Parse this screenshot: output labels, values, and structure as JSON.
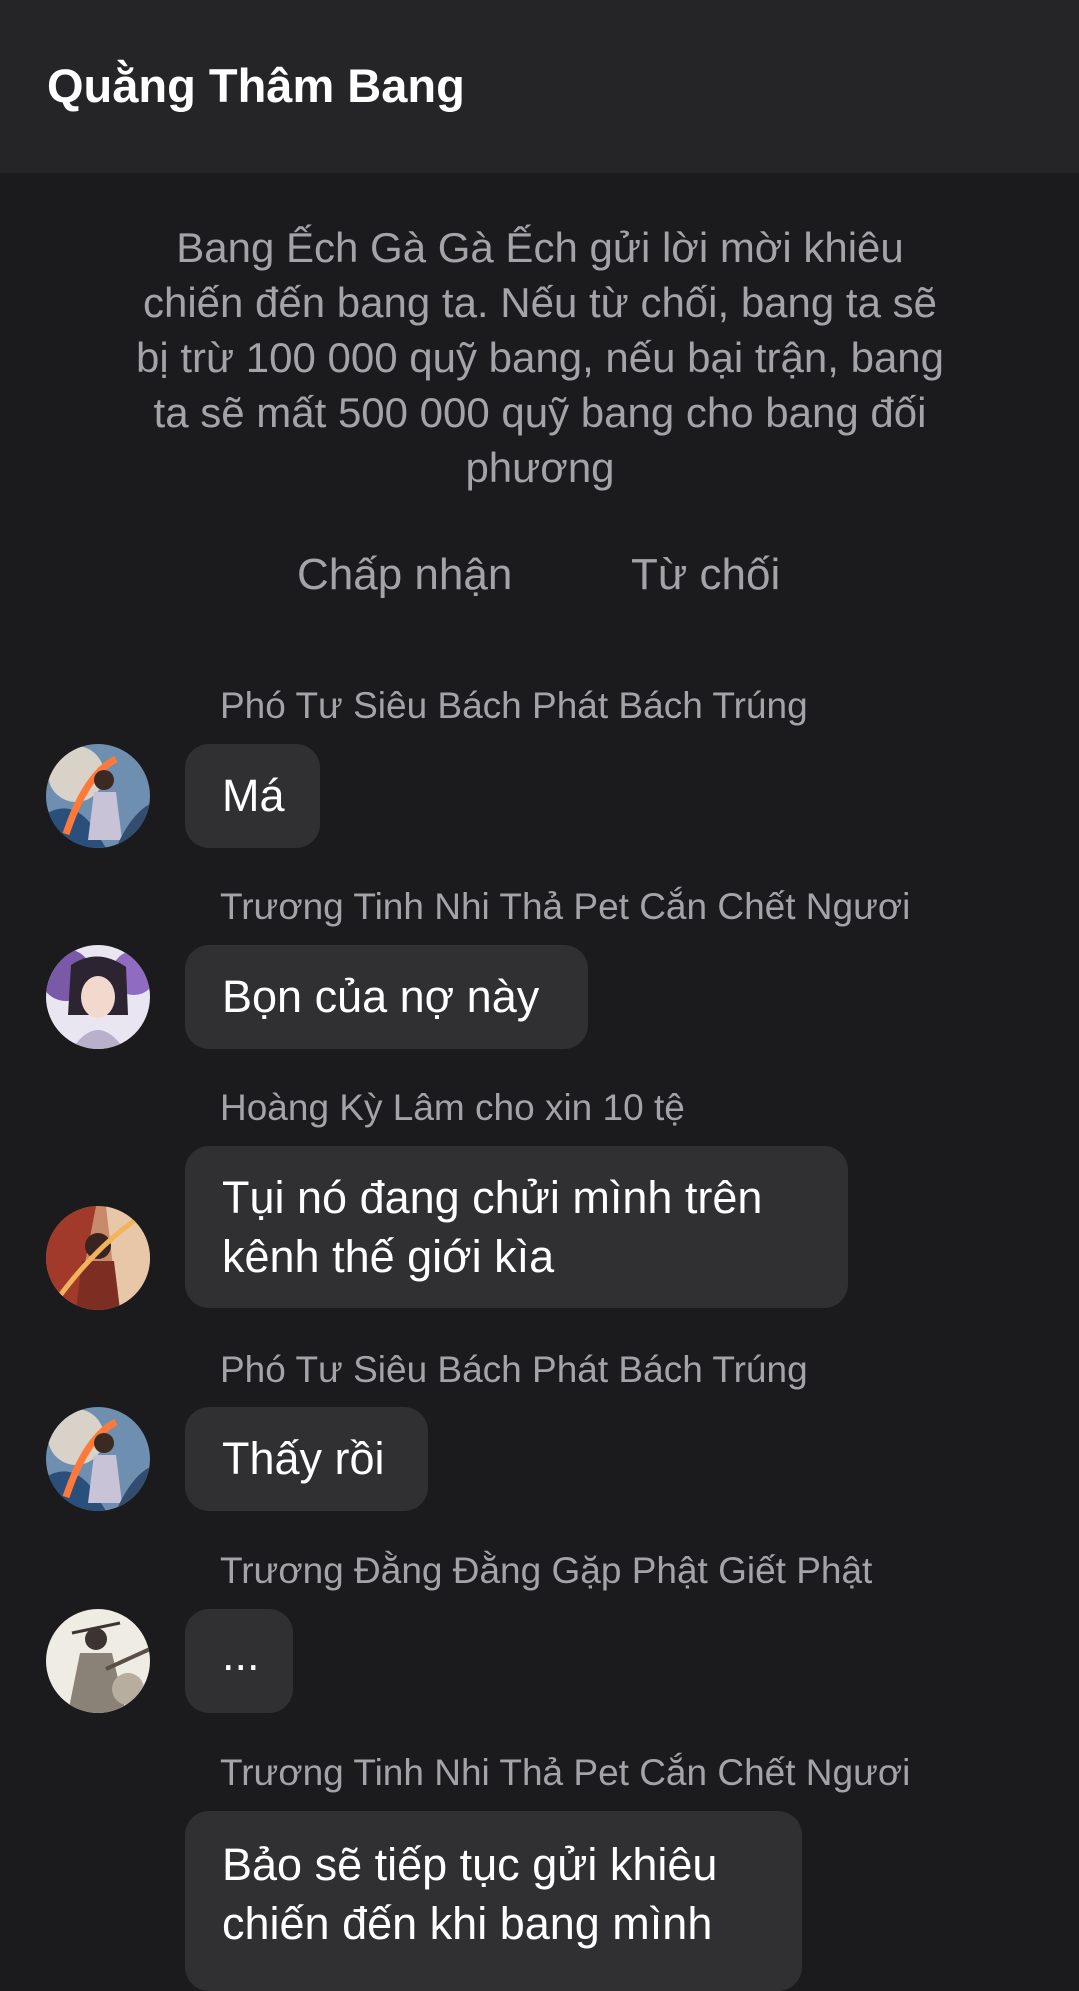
{
  "header": {
    "title": "Quằng Thâm Bang"
  },
  "system_message": {
    "text": "Bang Ếch Gà Gà Ếch gửi lời mời khiêu chiến đến bang ta. Nếu từ chối, bang ta sẽ bị trừ 100 000 quỹ bang, nếu bại trận, bang ta sẽ mất 500 000 quỹ bang cho bang đối phương",
    "accept_label": "Chấp nhận",
    "decline_label": "Từ chối"
  },
  "messages": [
    {
      "sender": "Phó Tư Siêu Bách Phát Bách Trúng",
      "text": "Má",
      "avatar": "warrior-avatar"
    },
    {
      "sender": "Trương Tinh Nhi Thả Pet Cắn Chết Ngươi",
      "text": "Bọn của nợ này",
      "avatar": "lady-avatar"
    },
    {
      "sender": "Hoàng Kỳ Lâm cho xin 10 tệ",
      "text": "Tụi nó đang chửi mình trên kênh thế giới kìa",
      "avatar": "fire-warrior-avatar"
    },
    {
      "sender": "Phó Tư Siêu Bách Phát Bách Trúng",
      "text": "Thấy rồi",
      "avatar": "warrior-avatar"
    },
    {
      "sender": "Trương Đằng Đằng Gặp Phật Giết Phật",
      "text": "...",
      "avatar": "ink-warrior-avatar"
    },
    {
      "sender": "Trương Tinh Nhi Thả Pet Cắn Chết Ngươi",
      "text": "Bảo sẽ tiếp tục gửi khiêu chiến đến khi bang mình",
      "avatar": "lady-avatar"
    }
  ],
  "colors": {
    "background": "#1b1b1d",
    "header": "#252527",
    "bubble": "#303033",
    "muted_text": "#a3a3a8"
  }
}
